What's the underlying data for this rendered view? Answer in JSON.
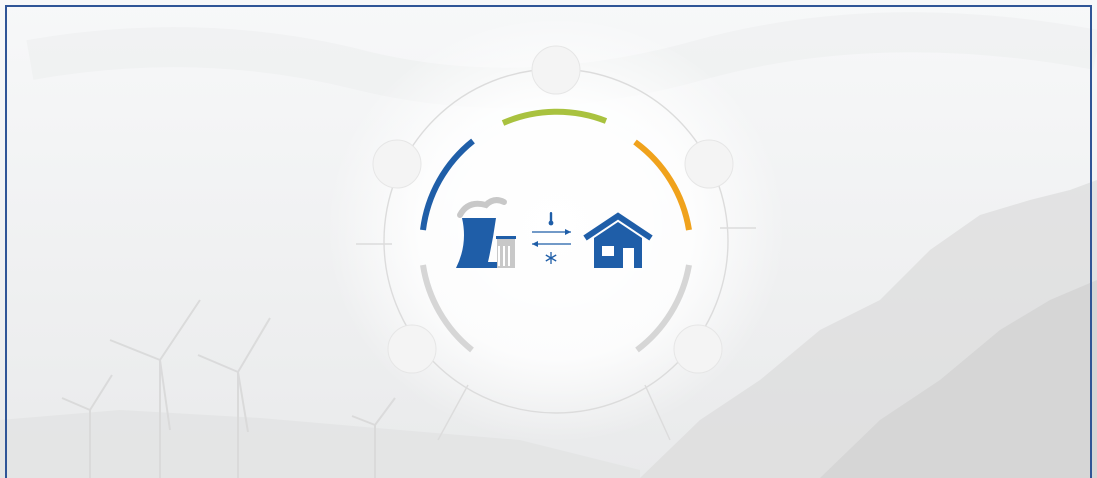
{
  "colors": {
    "frame": "#2f5597",
    "arc_top": "#a9c23f",
    "arc_upper_left": "#1f5ea8",
    "arc_upper_right": "#f0a21c",
    "arc_lower": "#d6d6d6",
    "icon_primary": "#1f5ea8",
    "icon_muted": "#c8c8c8"
  },
  "diagram": {
    "segments": [
      {
        "name": "top",
        "color": "#a9c23f"
      },
      {
        "name": "upper-left",
        "color": "#1f5ea8"
      },
      {
        "name": "upper-right",
        "color": "#f0a21c"
      },
      {
        "name": "lower-left",
        "color": "#d6d6d6"
      },
      {
        "name": "lower-right",
        "color": "#d6d6d6"
      }
    ],
    "nodes": [
      "top",
      "upper-left",
      "upper-right",
      "lower-left",
      "lower-right"
    ],
    "center_icons": [
      "power-plant-icon",
      "thermometer-icon",
      "exchange-arrows-icon",
      "snowflake-icon",
      "house-icon"
    ]
  }
}
